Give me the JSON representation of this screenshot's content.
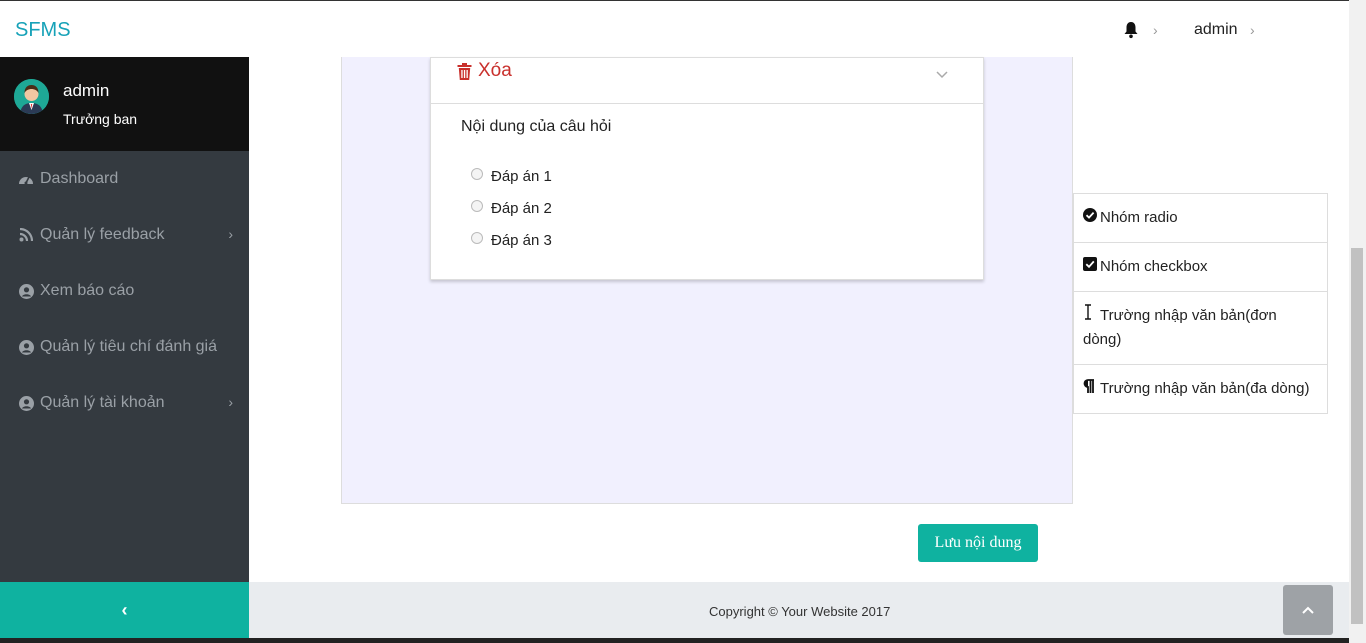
{
  "header": {
    "brand": "SFMS",
    "user": "admin"
  },
  "sidebar": {
    "user_name": "admin",
    "user_role": "Trưởng ban",
    "items": [
      {
        "label": "Dashboard",
        "icon": "dashboard-icon",
        "has_submenu": false
      },
      {
        "label": "Quản lý feedback",
        "icon": "rss-icon",
        "has_submenu": true
      },
      {
        "label": "Xem báo cáo",
        "icon": "user-circle-icon",
        "has_submenu": false
      },
      {
        "label": "Quản lý tiêu chí đánh giá",
        "icon": "user-circle-icon",
        "has_submenu": false
      },
      {
        "label": "Quản lý tài khoản",
        "icon": "user-circle-icon",
        "has_submenu": true
      }
    ],
    "toggle": "‹"
  },
  "card": {
    "delete_label": "Xóa",
    "question": "Nội dung của câu hỏi",
    "options": [
      "Đáp án 1",
      "Đáp án 2",
      "Đáp án 3"
    ]
  },
  "tools": [
    {
      "label": "Nhóm radio",
      "icon": "check-circle-icon"
    },
    {
      "label": "Nhóm checkbox",
      "icon": "check-square-icon"
    },
    {
      "label": "Trường nhập văn bản(đơn dòng)",
      "icon": "text-cursor-icon"
    },
    {
      "label": "Trường nhập văn bản(đa dòng)",
      "icon": "paragraph-icon"
    }
  ],
  "save_label": "Lưu nội dung",
  "footer": {
    "copyright": "Copyright © Your Website 2017"
  },
  "colors": {
    "brand": "#17a2b8",
    "accent": "#0fb2a0",
    "danger": "#c9302c",
    "sidebar": "#343a40"
  }
}
